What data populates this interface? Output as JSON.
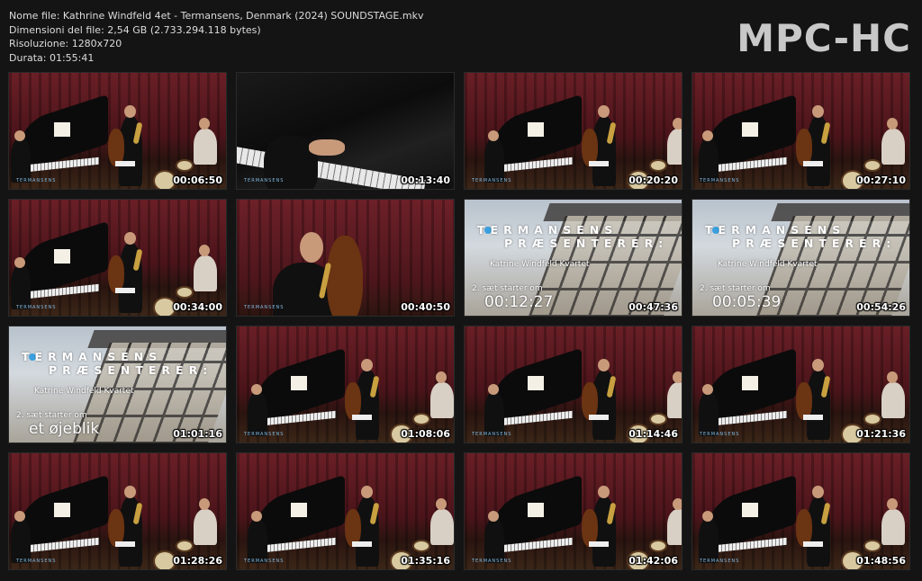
{
  "info": {
    "filename": "Nome file: Kathrine Windfeld 4et - Termansens, Denmark (2024) SOUNDSTAGE.mkv",
    "filesize": "Dimensioni del file: 2,54 GB (2.733.294.118 bytes)",
    "resolution": "Risoluzione: 1280x720",
    "duration": "Durata: 01:55:41"
  },
  "logo": "MPC-HC",
  "brand_tag": "TERMANSENS",
  "poster": {
    "line1": "TERMANSENS",
    "line2": "PRÆSENTERER:",
    "subtitle": "Katrine Windfeld Kvartet",
    "set_label": "2. sæt starter om"
  },
  "thumbnails": [
    {
      "time": "00:06:50",
      "scene": "concert"
    },
    {
      "time": "00:13:40",
      "scene": "keys"
    },
    {
      "time": "00:20:20",
      "scene": "concert"
    },
    {
      "time": "00:27:10",
      "scene": "concert"
    },
    {
      "time": "00:34:00",
      "scene": "concert"
    },
    {
      "time": "00:40:50",
      "scene": "bass"
    },
    {
      "time": "00:47:36",
      "scene": "poster",
      "countdown": "00:12:27"
    },
    {
      "time": "00:54:26",
      "scene": "poster",
      "countdown": "00:05:39"
    },
    {
      "time": "01:01:16",
      "scene": "poster",
      "countdown": "et øjeblik"
    },
    {
      "time": "01:08:06",
      "scene": "concert"
    },
    {
      "time": "01:14:46",
      "scene": "concert"
    },
    {
      "time": "01:21:36",
      "scene": "concert"
    },
    {
      "time": "01:28:26",
      "scene": "concert"
    },
    {
      "time": "01:35:16",
      "scene": "concert"
    },
    {
      "time": "01:42:06",
      "scene": "concert"
    },
    {
      "time": "01:48:56",
      "scene": "concert"
    }
  ]
}
